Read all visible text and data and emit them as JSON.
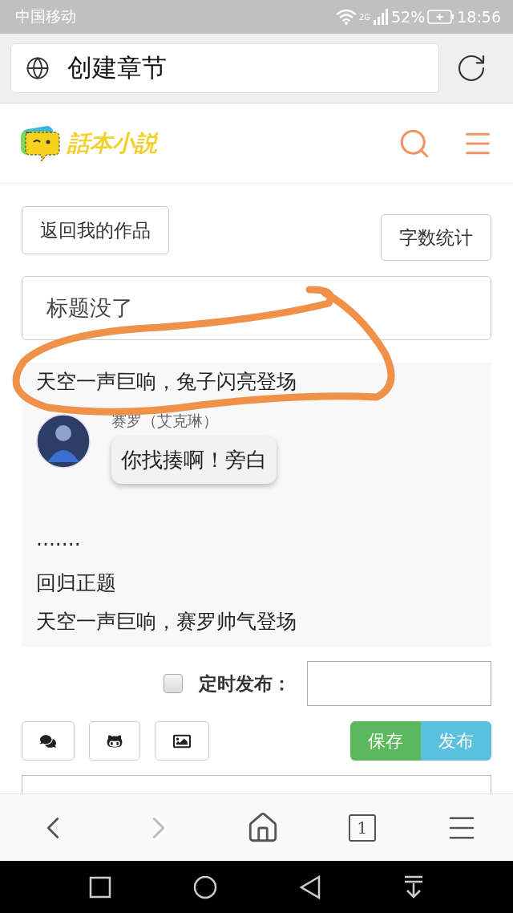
{
  "status_bar": {
    "carrier": "中国移动",
    "network": "2G",
    "battery": "52%",
    "time": "18:56"
  },
  "address_bar": {
    "title": "创建章节"
  },
  "site_header": {
    "logo_text": "話本小説"
  },
  "back_button": {
    "label": "返回我的作品"
  },
  "count_button": {
    "label": "字数统计"
  },
  "title_field": {
    "value": "标题没了"
  },
  "editor": {
    "blocks": [
      {
        "kind": "text",
        "text": "天空一声巨响，兔子闪亮登场"
      },
      {
        "kind": "dialogue",
        "speaker": "赛罗（艾克琳）",
        "text": "你找揍啊！旁白"
      },
      {
        "kind": "text",
        "text": "·······"
      },
      {
        "kind": "text",
        "text": "回归正题"
      },
      {
        "kind": "text",
        "text": "天空一声巨响，赛罗帅气登场"
      }
    ]
  },
  "schedule": {
    "checked": false,
    "label": "定时发布："
  },
  "actions": [
    {
      "kind": "save",
      "label": "保存"
    },
    {
      "kind": "publish",
      "label": "发布"
    }
  ],
  "browser_nav": {
    "forward_disabled": true,
    "tab_count": "1"
  }
}
